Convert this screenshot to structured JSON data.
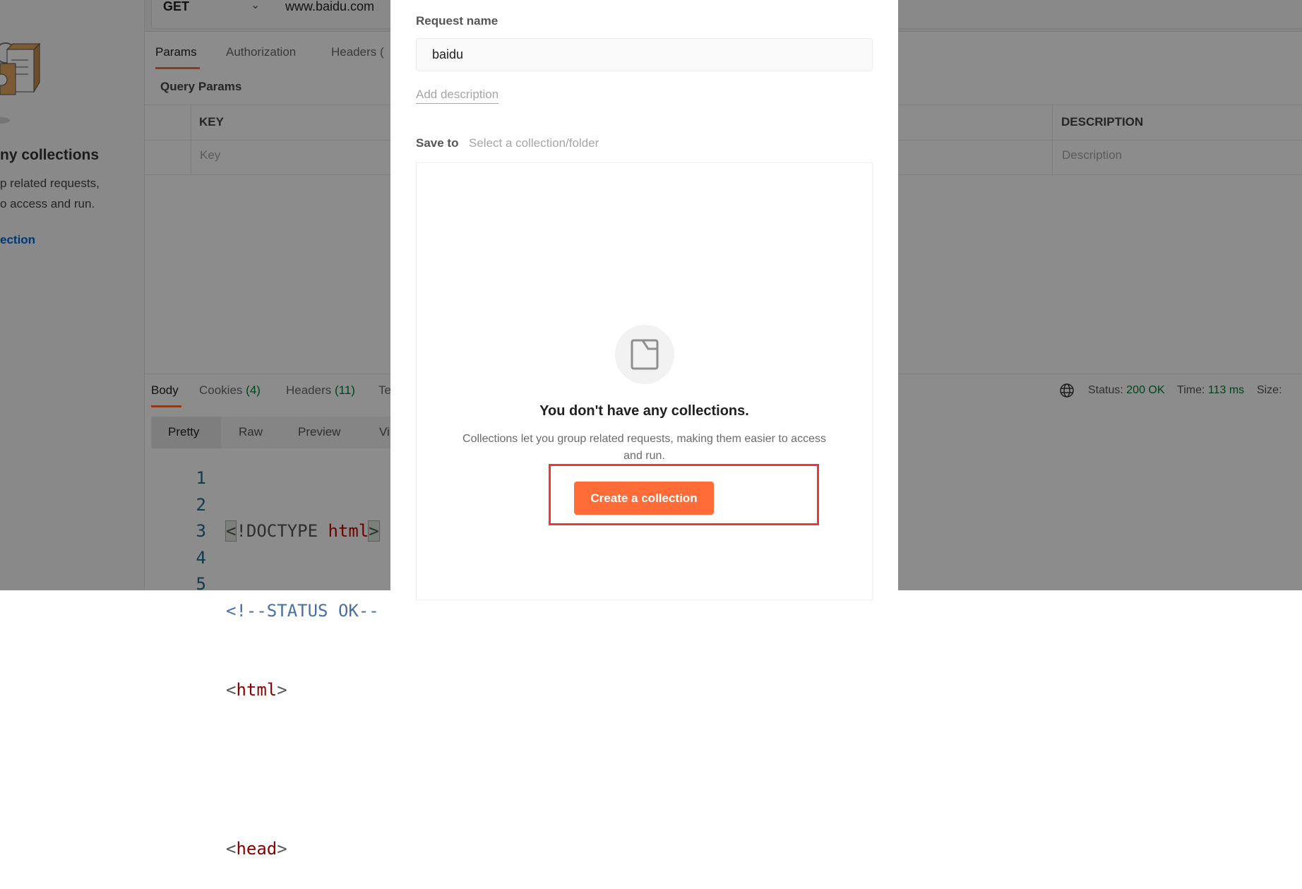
{
  "sidebar": {
    "empty_title": "ny collections",
    "empty_line1": "p related requests,",
    "empty_line2": "o access and run.",
    "create_link": "ection"
  },
  "request": {
    "method": "GET",
    "url": "www.baidu.com",
    "tabs": [
      "Params",
      "Authorization",
      "Headers ("
    ],
    "query_params_label": "Query Params",
    "columns": {
      "key": "KEY",
      "description": "DESCRIPTION"
    },
    "placeholders": {
      "key": "Key",
      "description": "Description"
    }
  },
  "response": {
    "tabs": [
      {
        "label": "Body"
      },
      {
        "label": "Cookies",
        "count": "(4)"
      },
      {
        "label": "Headers",
        "count": "(11)"
      },
      {
        "label": "Te"
      }
    ],
    "views": [
      "Pretty",
      "Raw",
      "Preview",
      "Vi"
    ],
    "status_label": "Status:",
    "status_value": "200 OK",
    "time_label": "Time:",
    "time_value": "113 ms",
    "size_label": "Size:",
    "code_lines": [
      {
        "num": "1"
      },
      {
        "num": "2",
        "text": "<!--STATUS OK--"
      },
      {
        "num": "3"
      },
      {
        "num": "4"
      },
      {
        "num": "5"
      }
    ],
    "line1": {
      "open": "<",
      "doctype": "!DOCTYPE ",
      "html": "html",
      "close": ">"
    },
    "line3": {
      "lt": "<",
      "tag": "html",
      "gt": ">"
    },
    "line5": {
      "lt": "<",
      "tag": "head",
      "gt": ">"
    }
  },
  "modal": {
    "request_name_label": "Request name",
    "request_name_value": "baidu",
    "add_description": "Add description",
    "save_to_label": "Save to",
    "save_to_placeholder": "Select a collection/folder",
    "empty_title": "You don't have any collections.",
    "empty_desc_line1": "Collections let you group related requests, making them easier to access",
    "empty_desc_line2": "and run.",
    "create_button": "Create a collection"
  },
  "colors": {
    "accent": "#ff6c37",
    "success": "#007f31",
    "highlight": "#f0353a",
    "link": "#0265d2"
  }
}
